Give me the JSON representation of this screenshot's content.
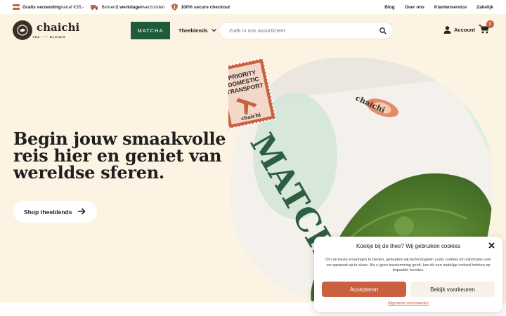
{
  "topbar": {
    "usp1_bold": "Gratis verzending",
    "usp1_rest": " vanaf €35,-",
    "usp2_lite": "Binnen ",
    "usp2_bold": "2 werkdagen",
    "usp2_rest": " verzonden",
    "usp3": "100% secure checkout",
    "links": [
      "Blog",
      "Over ons",
      "Klantenservice",
      "Zakelijk"
    ]
  },
  "header": {
    "logo_text": "chaichi",
    "logo_sub": "TEA ~~~ BLENDS",
    "matcha_label": "MATCHA",
    "blends_label": "Theeblends",
    "search_placeholder": "Zoek in ons assortiment",
    "account_label": "Account",
    "cart_count": "0"
  },
  "hero": {
    "title": "Begin jouw smaakvolle reis hier en geniet van wereldse sferen.",
    "cta_label": "Shop theeblends",
    "stamp_lines": [
      "PRIORITY",
      "DOMESTIC",
      "TRANSPORT"
    ],
    "stamp_brand": "chaichi",
    "package_text": "MATCHA",
    "package_brand": "chaichi"
  },
  "cookie": {
    "title": "Koekje bij de thee? Wij gebruiken cookies",
    "body": "Om de beste ervaringen te bieden, gebruiken wij technologieën zoals cookies om informatie over uw apparaat op te slaan. Als u geen toestemming geeft, kan dit een nadelige invloed hebben op bepaalde functies.",
    "accept_label": "Accepteren",
    "prefs_label": "Bekijk voorkeuren",
    "terms_label": "Algemene voorwaarden"
  },
  "colors": {
    "background": "#fdf3e3",
    "brand_green": "#1f5a3a",
    "accent": "#c9603f",
    "matcha_green": "#4f7a2c"
  }
}
